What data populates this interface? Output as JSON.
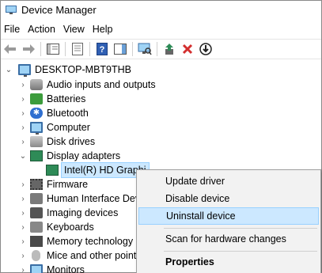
{
  "window": {
    "title": "Device Manager"
  },
  "menubar": {
    "items": [
      "File",
      "Action",
      "View",
      "Help"
    ]
  },
  "toolbar": {
    "buttons": [
      "back-arrow-icon",
      "forward-arrow-icon",
      "show-hide-console-tree-icon",
      "properties-icon",
      "help-icon",
      "action-pane-icon",
      "scan-hardware-icon",
      "update-driver-icon",
      "uninstall-icon",
      "disable-device-icon"
    ],
    "colors": {
      "update": "#2e8b57",
      "uninstall": "#d32f2f"
    }
  },
  "tree": {
    "root": "DESKTOP-MBT9THB",
    "items": [
      {
        "label": "Audio inputs and outputs",
        "icon": "speaker-icon"
      },
      {
        "label": "Batteries",
        "icon": "battery-icon"
      },
      {
        "label": "Bluetooth",
        "icon": "bluetooth-icon"
      },
      {
        "label": "Computer",
        "icon": "computer-icon"
      },
      {
        "label": "Disk drives",
        "icon": "disk-icon"
      },
      {
        "label": "Display adapters",
        "icon": "display-adapter-icon",
        "expanded": true
      },
      {
        "label": "Intel(R) HD Graphi",
        "icon": "display-adapter-icon",
        "selected": true
      },
      {
        "label": "Firmware",
        "icon": "chip-icon"
      },
      {
        "label": "Human Interface Devic",
        "icon": "hid-icon"
      },
      {
        "label": "Imaging devices",
        "icon": "camera-icon"
      },
      {
        "label": "Keyboards",
        "icon": "keyboard-icon"
      },
      {
        "label": "Memory technology d",
        "icon": "memory-icon"
      },
      {
        "label": "Mice and other pointi",
        "icon": "mouse-icon"
      },
      {
        "label": "Monitors",
        "icon": "monitor-icon"
      }
    ]
  },
  "context_menu": {
    "update_driver": "Update driver",
    "disable_device": "Disable device",
    "uninstall_device": "Uninstall device",
    "scan_hardware": "Scan for hardware changes",
    "properties": "Properties"
  }
}
